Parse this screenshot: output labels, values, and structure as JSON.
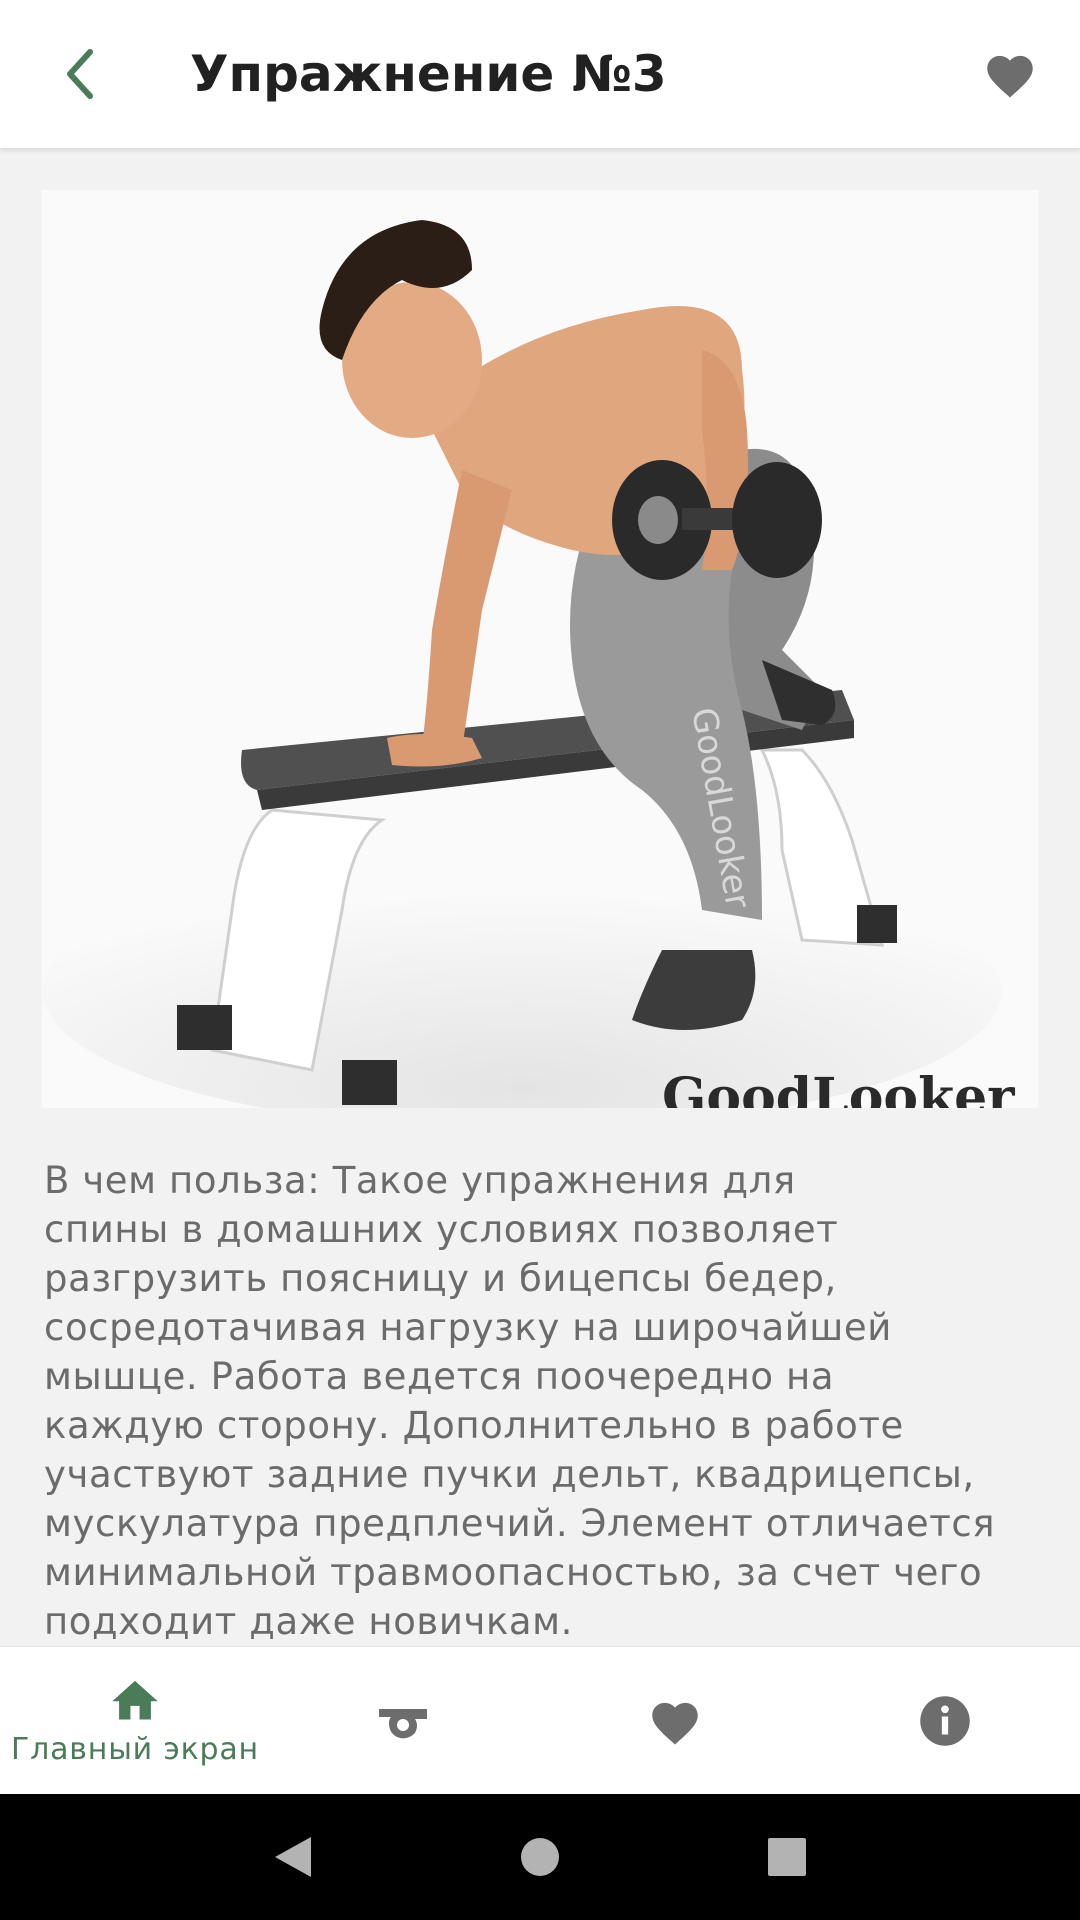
{
  "header": {
    "title": "Упражнение №3",
    "back_icon": "chevron-left-icon",
    "favorite_icon": "heart-icon"
  },
  "exercise": {
    "image_watermark_leg": "GoodLooker",
    "image_watermark_bottom": "GoodLooker",
    "description": "В чем польза: Такое упражнения для\nспины в домашних условиях позволяет\nразгрузить поясницу и бицепсы бедер,\nсосредотачивая нагрузку на широчайшей\nмышце. Работа ведется поочередно на\nкаждую сторону. Дополнительно в работе\nучаствуют задние пучки дельт, квадрицепсы,\nмускулатура предплечий. Элемент отличается\nминимальной травмоопасностью, за счет чего\nподходит даже новичкам."
  },
  "bottom_nav": {
    "items": [
      {
        "label": "Главный экран",
        "icon": "home-icon",
        "active": true
      },
      {
        "label": "",
        "icon": "whistle-icon",
        "active": false
      },
      {
        "label": "",
        "icon": "heart-icon",
        "active": false
      },
      {
        "label": "",
        "icon": "info-icon",
        "active": false
      }
    ]
  },
  "colors": {
    "accent": "#4a7c59",
    "icon_gray": "#6d6d6d",
    "text": "#212121",
    "description_text": "#6b6b6b",
    "background": "#f2f2f2"
  },
  "system_nav": {
    "back": "triangle-back-icon",
    "home": "circle-home-icon",
    "recents": "square-recents-icon"
  }
}
